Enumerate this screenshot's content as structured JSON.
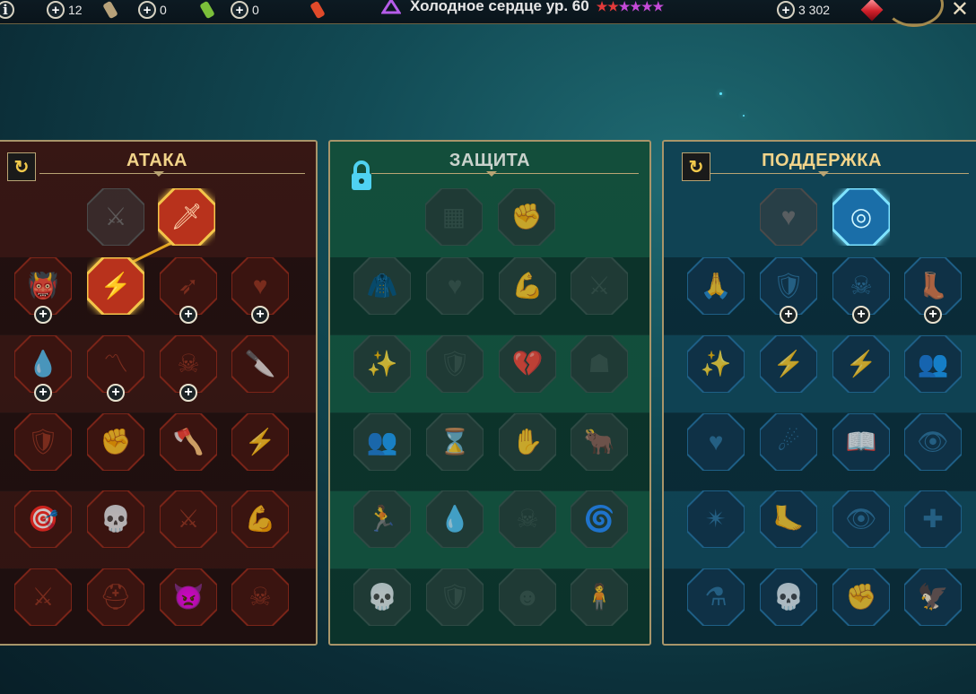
{
  "topbar": {
    "info_icon": "info-icon",
    "resources": [
      {
        "value": "12",
        "potion_color": "#b8a27a"
      },
      {
        "value": "0",
        "potion_color": "#7bbf3a"
      },
      {
        "value": "0",
        "potion_color": "#e04a2a"
      }
    ],
    "hero_name": "Холодное сердце ур. 60",
    "stars": "★★★★★★",
    "star_colors": [
      "#e23a3a",
      "#e23a3a",
      "#c54ad8",
      "#c54ad8",
      "#c54ad8",
      "#c54ad8"
    ],
    "gems": "3 302",
    "close_symbol": "✕"
  },
  "panels": [
    {
      "title": "АТАКА",
      "theme": "attack",
      "title_color": "#f2d48a",
      "has_reset": true,
      "reset_icon": "↻",
      "locked": false,
      "rows": [
        {
          "nodes": [
            {
              "icon": "crossed-swords-icon",
              "glyph": "⚔",
              "state": "inactive",
              "plus": false
            },
            {
              "icon": "dagger-slash-icon",
              "glyph": "🗡",
              "state": "active",
              "plus": false
            }
          ]
        },
        {
          "nodes": [
            {
              "icon": "horned-demon-icon",
              "glyph": "👹",
              "state": "dim",
              "plus": true
            },
            {
              "icon": "spear-burst-icon",
              "glyph": "⚡",
              "state": "active",
              "plus": false
            },
            {
              "icon": "arrow-hand-icon",
              "glyph": "➶",
              "state": "dim",
              "plus": true
            },
            {
              "icon": "thorned-heart-icon",
              "glyph": "♥",
              "state": "dim",
              "plus": true
            }
          ]
        },
        {
          "nodes": [
            {
              "icon": "blood-drop-icon",
              "glyph": "💧",
              "state": "dim",
              "plus": true
            },
            {
              "icon": "fangs-icon",
              "glyph": "〽",
              "state": "dim",
              "plus": true
            },
            {
              "icon": "skull-slash-icon",
              "glyph": "☠",
              "state": "dim",
              "plus": true
            },
            {
              "icon": "knife-grip-icon",
              "glyph": "🔪",
              "state": "dim",
              "plus": false
            }
          ]
        },
        {
          "nodes": [
            {
              "icon": "sword-shield-icon",
              "glyph": "🛡",
              "state": "dim",
              "plus": false
            },
            {
              "icon": "fist-bar-icon",
              "glyph": "✊",
              "state": "dim",
              "plus": false
            },
            {
              "icon": "axe-icon",
              "glyph": "🪓",
              "state": "dim",
              "plus": false
            },
            {
              "icon": "lightning-chain-icon",
              "glyph": "⚡",
              "state": "dim",
              "plus": false
            }
          ]
        },
        {
          "nodes": [
            {
              "icon": "arrows-target-icon",
              "glyph": "🎯",
              "state": "dim",
              "plus": false
            },
            {
              "icon": "skull-icon",
              "glyph": "💀",
              "state": "dim",
              "plus": false
            },
            {
              "icon": "sword-circle-icon",
              "glyph": "⚔",
              "state": "dim",
              "plus": false
            },
            {
              "icon": "flexing-warrior-icon",
              "glyph": "💪",
              "state": "dim",
              "plus": false
            }
          ]
        },
        {
          "nodes": [
            {
              "icon": "crossed-blades-icon",
              "glyph": "⚔",
              "state": "dim",
              "plus": false
            },
            {
              "icon": "flaming-helm-icon",
              "glyph": "⛑",
              "state": "dim",
              "plus": false
            },
            {
              "icon": "demon-icon",
              "glyph": "👿",
              "state": "dim",
              "plus": false
            },
            {
              "icon": "flaming-skull-icon",
              "glyph": "☠",
              "state": "dim",
              "plus": false
            }
          ]
        }
      ]
    },
    {
      "title": "ЗАЩИТА",
      "theme": "defense",
      "title_color": "#c9d2cc",
      "has_reset": false,
      "locked": true,
      "rows": [
        {
          "nodes": [
            {
              "icon": "armor-plates-icon",
              "glyph": "▦",
              "state": "inactive",
              "plus": false
            },
            {
              "icon": "raised-fist-icon",
              "glyph": "✊",
              "state": "inactive",
              "plus": false
            }
          ]
        },
        {
          "nodes": [
            {
              "icon": "cloak-icon",
              "glyph": "🧥",
              "state": "inactive",
              "plus": false
            },
            {
              "icon": "heart-organ-icon",
              "glyph": "♥",
              "state": "inactive",
              "plus": false
            },
            {
              "icon": "muscle-body-icon",
              "glyph": "💪",
              "state": "inactive",
              "plus": false
            },
            {
              "icon": "deflect-icon",
              "glyph": "⚔",
              "state": "inactive",
              "plus": false
            }
          ]
        },
        {
          "nodes": [
            {
              "icon": "magic-figure-icon",
              "glyph": "✨",
              "state": "inactive",
              "plus": false
            },
            {
              "icon": "shield-knight-icon",
              "glyph": "🛡",
              "state": "inactive",
              "plus": false
            },
            {
              "icon": "cracked-heart-icon",
              "glyph": "💔",
              "state": "inactive",
              "plus": false
            },
            {
              "icon": "hooded-head-icon",
              "glyph": "☗",
              "state": "inactive",
              "plus": false
            }
          ]
        },
        {
          "nodes": [
            {
              "icon": "crowd-icon",
              "glyph": "👥",
              "state": "inactive",
              "plus": false
            },
            {
              "icon": "hourglass-icon",
              "glyph": "⌛",
              "state": "inactive",
              "plus": false
            },
            {
              "icon": "open-hand-icon",
              "glyph": "✋",
              "state": "inactive",
              "plus": false
            },
            {
              "icon": "bull-head-icon",
              "glyph": "🐂",
              "state": "inactive",
              "plus": false
            }
          ]
        },
        {
          "nodes": [
            {
              "icon": "running-figure-icon",
              "glyph": "🏃",
              "state": "inactive",
              "plus": false
            },
            {
              "icon": "drops-icon",
              "glyph": "💧",
              "state": "inactive",
              "plus": false
            },
            {
              "icon": "skull-rays-icon",
              "glyph": "☠",
              "state": "inactive",
              "plus": false
            },
            {
              "icon": "swirl-icon",
              "glyph": "🌀",
              "state": "inactive",
              "plus": false
            }
          ]
        },
        {
          "nodes": [
            {
              "icon": "angry-skull-icon",
              "glyph": "💀",
              "state": "inactive",
              "plus": false
            },
            {
              "icon": "winged-shield-icon",
              "glyph": "🛡",
              "state": "inactive",
              "plus": false
            },
            {
              "icon": "bearded-head-icon",
              "glyph": "☻",
              "state": "inactive",
              "plus": false
            },
            {
              "icon": "strong-figure-icon",
              "glyph": "🧍",
              "state": "inactive",
              "plus": false
            }
          ]
        }
      ]
    },
    {
      "title": "ПОДДЕРЖКА",
      "theme": "support",
      "title_color": "#f2d48a",
      "has_reset": true,
      "reset_icon": "↻",
      "locked": false,
      "rows": [
        {
          "nodes": [
            {
              "icon": "heart-sparkles-icon",
              "glyph": "♥",
              "state": "inactive",
              "plus": false
            },
            {
              "icon": "target-burst-icon",
              "glyph": "◎",
              "state": "active",
              "plus": false
            }
          ]
        },
        {
          "nodes": [
            {
              "icon": "praying-hands-icon",
              "glyph": "🙏",
              "state": "dim",
              "plus": false
            },
            {
              "icon": "shield-wave-icon",
              "glyph": "🛡",
              "state": "dim",
              "plus": true
            },
            {
              "icon": "flaming-skull-icon",
              "glyph": "☠",
              "state": "dim",
              "plus": true
            },
            {
              "icon": "speed-boot-icon",
              "glyph": "👢",
              "state": "dim",
              "plus": true
            }
          ]
        },
        {
          "nodes": [
            {
              "icon": "blessed-figure-icon",
              "glyph": "✨",
              "state": "dim",
              "plus": false
            },
            {
              "icon": "lightning-shield-icon",
              "glyph": "⚡",
              "state": "dim",
              "plus": false
            },
            {
              "icon": "shatter-icon",
              "glyph": "⚡",
              "state": "dim",
              "plus": false
            },
            {
              "icon": "group-icon",
              "glyph": "👥",
              "state": "dim",
              "plus": false
            }
          ]
        },
        {
          "nodes": [
            {
              "icon": "chained-heart-icon",
              "glyph": "♥",
              "state": "dim",
              "plus": false
            },
            {
              "icon": "comet-icon",
              "glyph": "☄",
              "state": "dim",
              "plus": false
            },
            {
              "icon": "open-book-icon",
              "glyph": "📖",
              "state": "dim",
              "plus": false
            },
            {
              "icon": "angry-eyes-icon",
              "glyph": "👁",
              "state": "dim",
              "plus": false
            }
          ]
        },
        {
          "nodes": [
            {
              "icon": "compass-star-icon",
              "glyph": "✴",
              "state": "dim",
              "plus": false
            },
            {
              "icon": "winged-foot-icon",
              "glyph": "🦶",
              "state": "dim",
              "plus": false
            },
            {
              "icon": "eye-icon",
              "glyph": "👁",
              "state": "dim",
              "plus": false
            },
            {
              "icon": "voodoo-doll-icon",
              "glyph": "✚",
              "state": "dim",
              "plus": false
            }
          ]
        },
        {
          "nodes": [
            {
              "icon": "poison-flask-icon",
              "glyph": "⚗",
              "state": "dim",
              "plus": false
            },
            {
              "icon": "winged-skull-icon",
              "glyph": "💀",
              "state": "dim",
              "plus": false
            },
            {
              "icon": "fist-chains-icon",
              "glyph": "✊",
              "state": "dim",
              "plus": false
            },
            {
              "icon": "eagle-icon",
              "glyph": "🦅",
              "state": "dim",
              "plus": false
            }
          ]
        }
      ]
    }
  ]
}
